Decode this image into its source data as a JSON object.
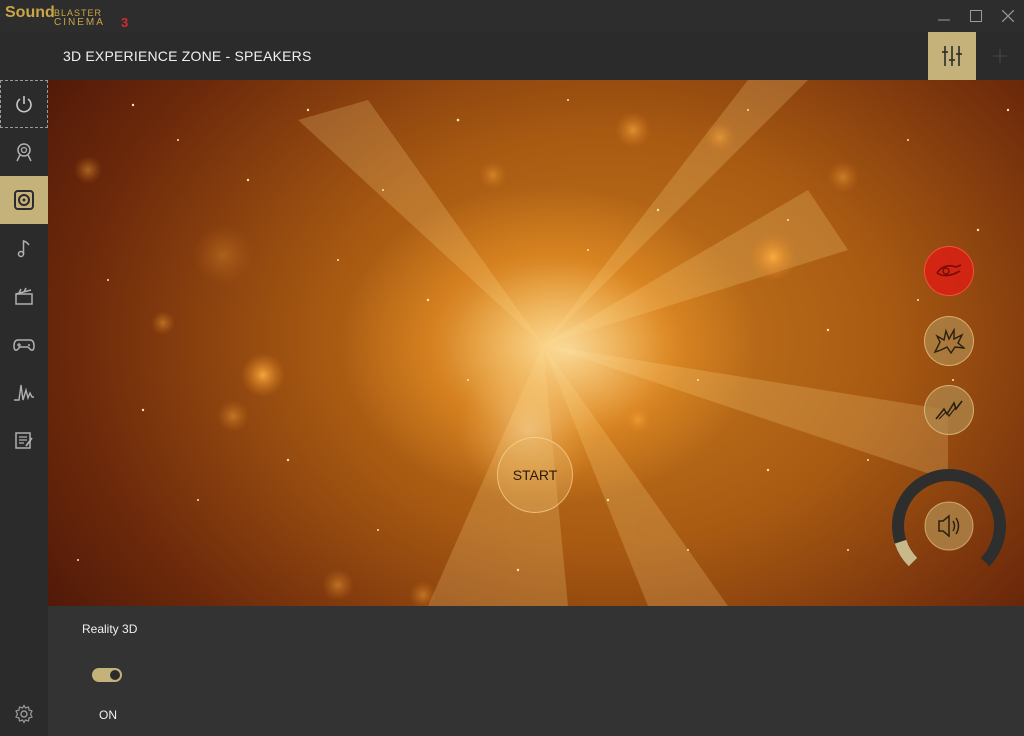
{
  "app": {
    "logo_word1": "Sound",
    "logo_word2": "BLASTER",
    "logo_word3": "CINEMA",
    "logo_version": "3"
  },
  "header": {
    "title": "3D EXPERIENCE ZONE - SPEAKERS"
  },
  "sidebar": {
    "items": [
      {
        "icon": "power-icon",
        "state": "focused"
      },
      {
        "icon": "user-profile-icon",
        "state": "normal"
      },
      {
        "icon": "speaker-icon",
        "state": "active"
      },
      {
        "icon": "music-note-icon",
        "state": "normal"
      },
      {
        "icon": "clapperboard-icon",
        "state": "normal"
      },
      {
        "icon": "gamepad-icon",
        "state": "normal"
      },
      {
        "icon": "waveform-icon",
        "state": "normal"
      },
      {
        "icon": "notes-icon",
        "state": "normal"
      }
    ],
    "settings_icon": "gear-icon"
  },
  "stage": {
    "start_label": "START",
    "effects": [
      {
        "icon": "surround-icon",
        "state": "selected"
      },
      {
        "icon": "explosion-icon",
        "state": "normal"
      },
      {
        "icon": "zigzag-icon",
        "state": "normal"
      }
    ],
    "volume_icon": "speaker-volume-icon",
    "volume_level_fraction": 0.1
  },
  "bottom": {
    "feature_label": "Reality 3D",
    "toggle_state": "ON"
  },
  "colors": {
    "accent": "#c4b27a",
    "logo_gold": "#c9a646",
    "logo_red": "#d22b2b",
    "selected_effect": "#dc1e14"
  }
}
